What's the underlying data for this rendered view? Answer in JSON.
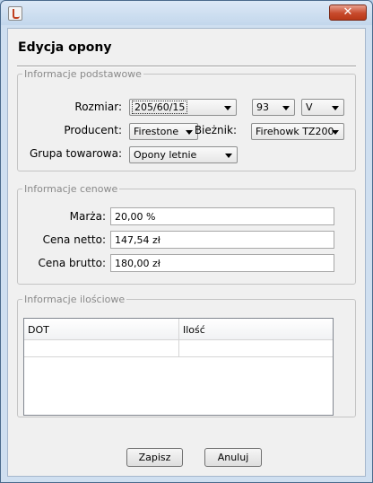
{
  "window": {
    "title": "",
    "app_icon": "java-icon",
    "close_symbol": "✕"
  },
  "dialog": {
    "title": "Edycja opony"
  },
  "basic": {
    "legend": "Informacje podstawowe",
    "size_label": "Rozmiar:",
    "size_value": "205/60/15",
    "load_index_value": "93",
    "speed_index_value": "V",
    "producer_label": "Producent:",
    "producer_value": "Firestone",
    "tread_label": "Bieżnik:",
    "tread_value": "Firehowk TZ200",
    "group_label": "Grupa towarowa:",
    "group_value": "Opony letnie"
  },
  "price": {
    "legend": "Informacje cenowe",
    "margin_label": "Marża:",
    "margin_value": "20,00 %",
    "net_label": "Cena netto:",
    "net_value": "147,54 zł",
    "gross_label": "Cena brutto:",
    "gross_value": "180,00 zł"
  },
  "quantity": {
    "legend": "Informacje ilościowe",
    "columns": [
      "DOT",
      "Ilość"
    ],
    "rows": [
      [
        "",
        ""
      ]
    ]
  },
  "buttons": {
    "save": "Zapisz",
    "cancel": "Anuluj"
  }
}
